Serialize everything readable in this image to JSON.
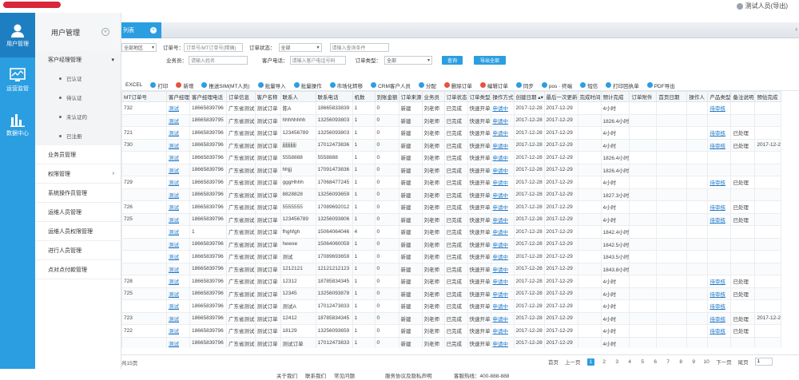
{
  "user": {
    "name": "测试人员(导出)"
  },
  "nav": [
    {
      "label": "用户管理",
      "icon": "user-icon",
      "active": true
    },
    {
      "label": "运营监管",
      "icon": "monitor-icon",
      "active": false
    },
    {
      "label": "数据中心",
      "icon": "chart-icon",
      "active": false
    }
  ],
  "sidebar": {
    "title": "用户管理",
    "collapse": "«",
    "group": "客户经理管理",
    "group_arrow": "▾",
    "subitems": [
      "已认证",
      "待认证",
      "未认证的",
      "已注册"
    ],
    "items": [
      {
        "label": "业务员管理",
        "arrow": ""
      },
      {
        "label": "权限管理",
        "arrow": "›"
      },
      {
        "label": "系统操作员管理",
        "arrow": ""
      },
      {
        "label": "运维人员管理",
        "arrow": ""
      },
      {
        "label": "运维人员权限管理",
        "arrow": ""
      },
      {
        "label": "进行人员管理",
        "arrow": ""
      },
      {
        "label": "点对点付款管理",
        "arrow": ""
      }
    ]
  },
  "tab": {
    "label": "列表",
    "close": "×"
  },
  "filters": {
    "row1": {
      "select1": "全部地区",
      "l_order": "订单号：",
      "ph_order": "订单号/MT订单号(精确)",
      "l_status": "订单状态：",
      "status": "全部",
      "ph_search": "请输入查询条件"
    },
    "row2": {
      "l_salesman": "业务员：",
      "ph_salesman": "请输入姓名",
      "l_phone": "客户电话：",
      "ph_phone": "请输入客户电话号码",
      "l_type": "订单类型：",
      "type": "全部",
      "btn_search": "查询",
      "btn_export": "导出全部"
    }
  },
  "toolbar": [
    {
      "label": "EXCEL",
      "color": ""
    },
    {
      "label": "打印",
      "color": "#2b9ee1"
    },
    {
      "label": "新增",
      "color": "#e5533d"
    },
    {
      "label": "推送SIM(MT人员)",
      "color": "#2b9ee1"
    },
    {
      "label": "批量导入",
      "color": "#2b9ee1"
    },
    {
      "label": "批量操作",
      "color": "#2b9ee1"
    },
    {
      "label": "市场化转移",
      "color": "#2b9ee1"
    },
    {
      "label": "CRM客户人员",
      "color": "#2b9ee1"
    },
    {
      "label": "分配",
      "color": "#2b9ee1"
    },
    {
      "label": "删除订单",
      "color": "#e5533d"
    },
    {
      "label": "编辑订单",
      "color": "#e5533d"
    },
    {
      "label": "同步",
      "color": "#2b9ee1"
    },
    {
      "label": "pos · 终端",
      "color": "#2b9ee1"
    },
    {
      "label": "短信",
      "color": "#2b9ee1"
    },
    {
      "label": "打印回执单",
      "color": "#2b9ee1"
    },
    {
      "label": "PDF导出",
      "color": "#2b9ee1"
    }
  ],
  "table": {
    "columns": [
      "MT订单号",
      "客户经理",
      "客户经理电话",
      "订单信息",
      "客户名称",
      "联系人",
      "联系电话",
      "机数",
      "到账金额",
      "订单来源",
      "业务员",
      "订单状态",
      "订单类型",
      "操作方式",
      "创建日期 ▴▾",
      "最后一次更新",
      "完成时间",
      "预计完成",
      "订单附件",
      "首页日期",
      "操作人",
      "产品类型",
      "备注说明",
      "预估完成"
    ],
    "widths": [
      56,
      28,
      46,
      30,
      32,
      44,
      46,
      28,
      30,
      26,
      28,
      24,
      26,
      26,
      38,
      34,
      26,
      28,
      34,
      38,
      26,
      28,
      30,
      24
    ],
    "rows": [
      [
        "732",
        "测试",
        "18665839796",
        "广东省测试",
        "测试订单",
        "陈A",
        "18665833839",
        "1",
        "0",
        "新建",
        "刘老师",
        "已完成",
        "快速开单",
        "申请中",
        "2017-12-28",
        "2017-12-29",
        "",
        "4小时",
        "",
        "",
        "",
        "待审核",
        "",
        ""
      ],
      [
        "",
        "测试",
        "18665839795",
        "广东省测试",
        "测试订单",
        "hhhhhhhh",
        "13256093803",
        "1",
        "0",
        "新建",
        "刘老师",
        "已完成",
        "快速开单",
        "申请中",
        "2017-12-28",
        "2017-12-29",
        "",
        "1826.4小时",
        "",
        "",
        "",
        "",
        "",
        ""
      ],
      [
        "721",
        "测试",
        "18665839796",
        "广东省测试",
        "测试订单",
        "123456789",
        "13256093803",
        "1",
        "0",
        "新建",
        "刘老师",
        "已完成",
        "快速开单",
        "申请中",
        "2017-12-28",
        "2017-12-29",
        "",
        "4小时",
        "",
        "",
        "",
        "待审核",
        "已处理",
        ""
      ],
      [
        "730",
        "测试",
        "18665839796",
        "广东省测试",
        "测试订单",
        "jjjjjjjjjjjj",
        "17012473836",
        "1",
        "0",
        "新建",
        "刘老师",
        "已完成",
        "快速开单",
        "申请中",
        "2017-12-28",
        "2017-12-29",
        "",
        "4小时",
        "",
        "",
        "",
        "待审核",
        "已处理",
        "2017-12-2"
      ],
      [
        "",
        "测试",
        "18665839796",
        "广东省测试",
        "测试订单",
        "5558888",
        "5558888",
        "1",
        "0",
        "新建",
        "刘老师",
        "已完成",
        "快速开单",
        "申请中",
        "2017-12-28",
        "2017-12-29",
        "",
        "1826.4小时",
        "",
        "",
        "",
        "",
        "",
        ""
      ],
      [
        "",
        "测试",
        "18665839796",
        "广东省测试",
        "测试订单",
        "hhjjj",
        "17091473836",
        "1",
        "0",
        "新建",
        "刘老师",
        "已完成",
        "快速开单",
        "申请中",
        "2017-12-28",
        "2017-12-29",
        "",
        "1826.4小时",
        "",
        "",
        "",
        "",
        "",
        ""
      ],
      [
        "729",
        "测试",
        "18665839796",
        "广东省测试",
        "测试订单",
        "gggHhhh",
        "17068477245",
        "1",
        "0",
        "新建",
        "刘老师",
        "已完成",
        "快速开单",
        "申请中",
        "2017-12-28",
        "2017-12-29",
        "",
        "4小时",
        "",
        "",
        "",
        "待审核",
        "已处理",
        ""
      ],
      [
        "",
        "测试",
        "18665839796",
        "广东省测试",
        "测试订单",
        "8828828",
        "13256093659",
        "1",
        "0",
        "新建",
        "刘老师",
        "已完成",
        "快速开单",
        "申请中",
        "2017-12-28",
        "2017-12-29",
        "",
        "1827.3小时",
        "",
        "",
        "",
        "",
        "",
        ""
      ],
      [
        "726",
        "测试",
        "18665839796",
        "广东省测试",
        "测试订单",
        "5555555",
        "17089692012",
        "1",
        "0",
        "新建",
        "刘老师",
        "已完成",
        "快速开单",
        "申请中",
        "2017-12-28",
        "2017-12-29",
        "",
        "4小时",
        "",
        "",
        "",
        "待审核",
        "已处理",
        ""
      ],
      [
        "725",
        "测试",
        "18665839796",
        "广东省测试",
        "测试订单",
        "123456789",
        "13256093806",
        "1",
        "0",
        "新建",
        "刘老师",
        "已完成",
        "快速开单",
        "申请中",
        "2017-12-28",
        "2017-12-29",
        "",
        "4小时",
        "",
        "",
        "",
        "待审核",
        "已处理",
        ""
      ],
      [
        "",
        "测试",
        "1",
        "广东省测试",
        "测试订单",
        "fhghfgh",
        "15064064046",
        "4",
        "0",
        "新建",
        "刘老师",
        "已完成",
        "快速开单",
        "申请中",
        "2017-12-28",
        "2017-12-29",
        "",
        "1842.4小时",
        "",
        "",
        "",
        "",
        "",
        ""
      ],
      [
        "",
        "测试",
        "18665839796",
        "广东省测试",
        "测试订单",
        "hewxe",
        "15064060059",
        "1",
        "0",
        "新建",
        "刘老师",
        "已完成",
        "快速开单",
        "申请中",
        "2017-12-28",
        "2017-12-29",
        "",
        "1842.5小时",
        "",
        "",
        "",
        "",
        "",
        ""
      ],
      [
        "",
        "测试",
        "18665839796",
        "广东省测试",
        "测试订单",
        "测试",
        "17089693659",
        "1",
        "0",
        "新建",
        "刘老师",
        "已完成",
        "快速开单",
        "申请中",
        "2017-12-28",
        "2017-12-29",
        "",
        "1843.5小时",
        "",
        "",
        "",
        "",
        "",
        ""
      ],
      [
        "",
        "测试",
        "18665839796",
        "广东省测试",
        "测试订单",
        "1212121",
        "12121212123",
        "1",
        "0",
        "新建",
        "刘老师",
        "已完成",
        "快速开单",
        "申请中",
        "2017-12-28",
        "2017-12-29",
        "",
        "1843.8小时",
        "",
        "",
        "",
        "",
        "",
        ""
      ],
      [
        "728",
        "测试",
        "18665839796",
        "广东省测试",
        "测试订单",
        "12312",
        "18785834345",
        "1",
        "0",
        "新建",
        "刘老师",
        "已完成",
        "快速开单",
        "申请中",
        "2017-12-28",
        "2017-12-29",
        "",
        "4小时",
        "",
        "",
        "",
        "待审核",
        "已处理",
        ""
      ],
      [
        "725",
        "测试",
        "18665839796",
        "广东省测试",
        "测试订单",
        "12345",
        "13256093878",
        "1",
        "0",
        "新建",
        "刘老师",
        "已完成",
        "快速开单",
        "申请中",
        "2017-12-28",
        "2017-12-29",
        "",
        "4小时",
        "",
        "",
        "",
        "待审核",
        "已处理",
        ""
      ],
      [
        "",
        "测试",
        "18665839796",
        "广东省测试",
        "测试订单",
        "测试A",
        "17012473833",
        "1",
        "0",
        "新建",
        "刘老师",
        "已完成",
        "快速开单",
        "申请中",
        "2017-12-28",
        "2017-12-29",
        "",
        "4小时",
        "",
        "",
        "",
        "待审核",
        "",
        ""
      ],
      [
        "723",
        "测试",
        "18665839796",
        "广东省测试",
        "测试订单",
        "12412",
        "18785834345",
        "1",
        "0",
        "新建",
        "刘老师",
        "已完成",
        "快速开单",
        "申请中",
        "2017-12-28",
        "2017-12-29",
        "",
        "4小时",
        "",
        "",
        "",
        "待审核",
        "已处理",
        "2017-12-2"
      ],
      [
        "722",
        "测试",
        "18665839796",
        "广东省测试",
        "测试订单",
        "18129",
        "13256093659",
        "1",
        "0",
        "新建",
        "刘老师",
        "已完成",
        "快速开单",
        "申请中",
        "2017-12-28",
        "2017-12-29",
        "",
        "4小时",
        "",
        "",
        "",
        "待审核",
        "已处理",
        ""
      ],
      [
        "",
        "测试",
        "18665839796",
        "广东省测试",
        "测试订单",
        "测试订单",
        "17012473833",
        "1",
        "0",
        "新建",
        "刘老师",
        "已完成",
        "快速开单",
        "申请中",
        "2017-12-28",
        "2017-12-29",
        "",
        "4小时",
        "",
        "",
        "",
        "",
        "",
        ""
      ]
    ]
  },
  "pager": {
    "total": "共15页",
    "first": "首页",
    "prev": "上一页",
    "pages": [
      "1",
      "2",
      "3",
      "4",
      "5",
      "6",
      "7",
      "8",
      "9",
      "10"
    ],
    "current": "1",
    "next": "下一页",
    "last": "尾页",
    "input": "1"
  },
  "footer": {
    "links": [
      "关于我们",
      "联系我们",
      "常见问题",
      "服务协议及隐私声明"
    ],
    "hotline": "客服热线：400-888-888"
  }
}
